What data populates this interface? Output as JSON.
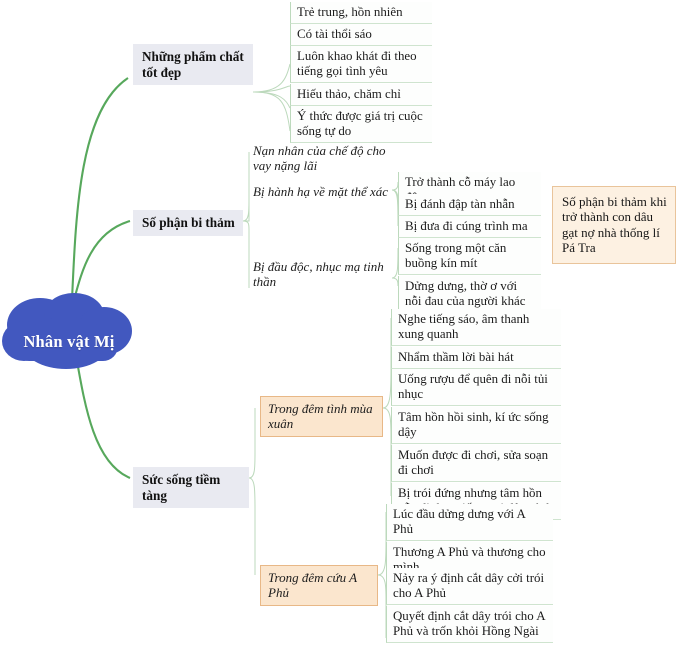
{
  "mindmap": {
    "root": {
      "label": "Nhân vật Mị",
      "shape": "cloud",
      "color": "#4258bf"
    },
    "branches": [
      {
        "label": "Những phẩm chất tốt đẹp",
        "children": [
          {
            "label": "Trẻ trung, hồn nhiên"
          },
          {
            "label": "Có tài thổi sáo"
          },
          {
            "label": "Luôn khao khát đi theo tiếng gọi tình yêu"
          },
          {
            "label": "Hiếu thảo, chăm chỉ"
          },
          {
            "label": "Ý thức được giá trị cuộc sống tự do"
          }
        ]
      },
      {
        "label": "Số phận bi thảm",
        "children": [
          {
            "label": "Nạn nhân của chế độ cho vay nặng lãi"
          },
          {
            "label": "Bị hành hạ về mặt thể xác",
            "children": [
              {
                "label": "Trở thành cỗ máy lao động"
              },
              {
                "label": "Bị đánh đập tàn nhẫn"
              },
              {
                "label": "Bị đưa đi cúng trình ma"
              }
            ]
          },
          {
            "label": "Bị đầu độc, nhục mạ tinh thần",
            "children": [
              {
                "label": "Sống trong một căn buồng kín mít"
              },
              {
                "label": "Dửng dưng, thờ ơ với nỗi đau của người khác"
              }
            ]
          }
        ],
        "summary": "Số phận bi thảm khi trở thành con dâu gạt nợ nhà thống lí Pá Tra"
      },
      {
        "label": "Sức sống tiềm tàng",
        "children": [
          {
            "label": "Trong đêm tình mùa xuân",
            "highlight": true,
            "children": [
              {
                "label": "Nghe tiếng sáo, âm thanh xung quanh"
              },
              {
                "label": "Nhẩm thầm lời bài hát"
              },
              {
                "label": "Uống rượu để quên đi nỗi tủi nhục"
              },
              {
                "label": "Tâm hồn hồi sinh, kí ức sống dậy"
              },
              {
                "label": "Muốn được đi chơi, sửa soạn đi chơi"
              },
              {
                "label": "Bị trói đứng nhưng tâm hồn vẫn đi theo tiếng gọi đêm tình"
              }
            ]
          },
          {
            "label": "Trong đêm cứu A Phủ",
            "highlight": true,
            "children": [
              {
                "label": "Lúc đầu dửng dưng với A Phủ"
              },
              {
                "label": "Thương A Phủ và thương cho mình"
              },
              {
                "label": "Nảy ra ý định cắt dây cởi trói cho A Phủ"
              },
              {
                "label": "Quyết định cắt dây trói cho A Phủ và trốn khỏi Hồng Ngài"
              }
            ]
          }
        ]
      }
    ]
  }
}
